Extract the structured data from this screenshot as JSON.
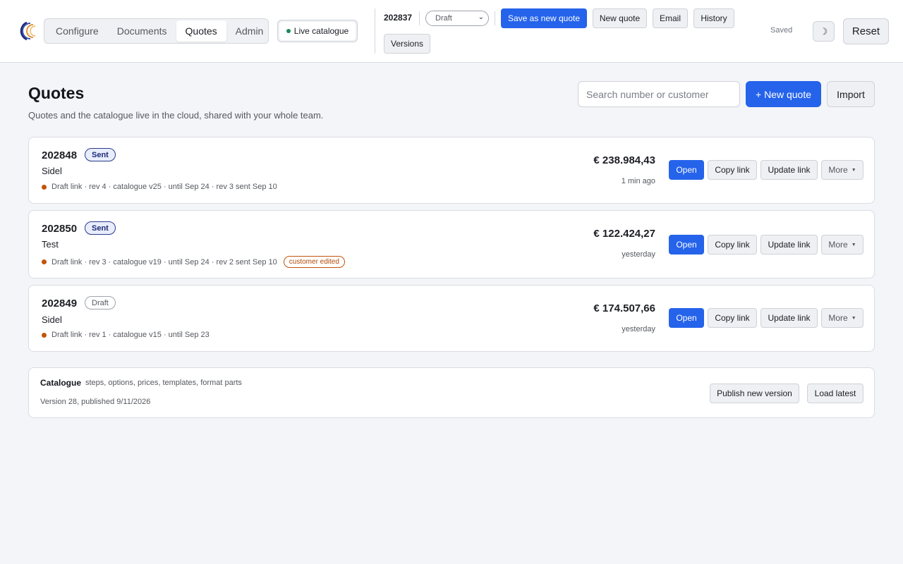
{
  "nav": {
    "tabs": [
      {
        "label": "Configure"
      },
      {
        "label": "Documents"
      },
      {
        "label": "Quotes"
      },
      {
        "label": "Admin"
      }
    ],
    "active_tab": "Quotes",
    "live_catalogue_label": "Live catalogue"
  },
  "toolbar": {
    "quote_number": "202837",
    "status_value": "Draft",
    "save_as_new_label": "Save as new quote",
    "new_quote_label": "New quote",
    "email_label": "Email",
    "history_label": "History",
    "versions_label": "Versions",
    "saved_label": "Saved",
    "theme_icon": "☽",
    "reset_label": "Reset"
  },
  "page": {
    "title": "Quotes",
    "subtitle": "Quotes and the catalogue live in the cloud, shared with your whole team.",
    "search_placeholder": "Search number or customer",
    "new_quote_label": "+ New quote",
    "import_label": "Import"
  },
  "quotes": [
    {
      "number": "202848",
      "status": "Sent",
      "customer": "Sidel",
      "meta": "Draft link · rev 4 · catalogue v25 · until Sep 24 · rev 3 sent Sep 10",
      "amount": "€ 238.984,43",
      "updated": "1 min ago",
      "customer_edited": ""
    },
    {
      "number": "202850",
      "status": "Sent",
      "customer": "Test",
      "meta": "Draft link · rev 3 · catalogue v19 · until Sep 24 · rev 2 sent Sep 10",
      "amount": "€ 122.424,27",
      "updated": "yesterday",
      "customer_edited": "customer edited"
    },
    {
      "number": "202849",
      "status": "Draft",
      "customer": "Sidel",
      "meta": "Draft link · rev 1 · catalogue v15 · until Sep 23",
      "amount": "€ 174.507,66",
      "updated": "yesterday",
      "customer_edited": ""
    }
  ],
  "quote_actions": {
    "open_label": "Open",
    "copy_link_label": "Copy link",
    "update_link_label": "Update link",
    "more_label": "More"
  },
  "catalogue": {
    "title": "Catalogue",
    "description": "steps, options, prices, templates, format parts",
    "version_text": "Version 28, published 9/11/2026",
    "publish_label": "Publish new version",
    "load_latest_label": "Load latest"
  },
  "colors": {
    "accent": "#2563eb",
    "sent_badge_border": "#2b3a8c",
    "status_dot": "#c2540a",
    "live_dot": "#1a8a5a"
  }
}
